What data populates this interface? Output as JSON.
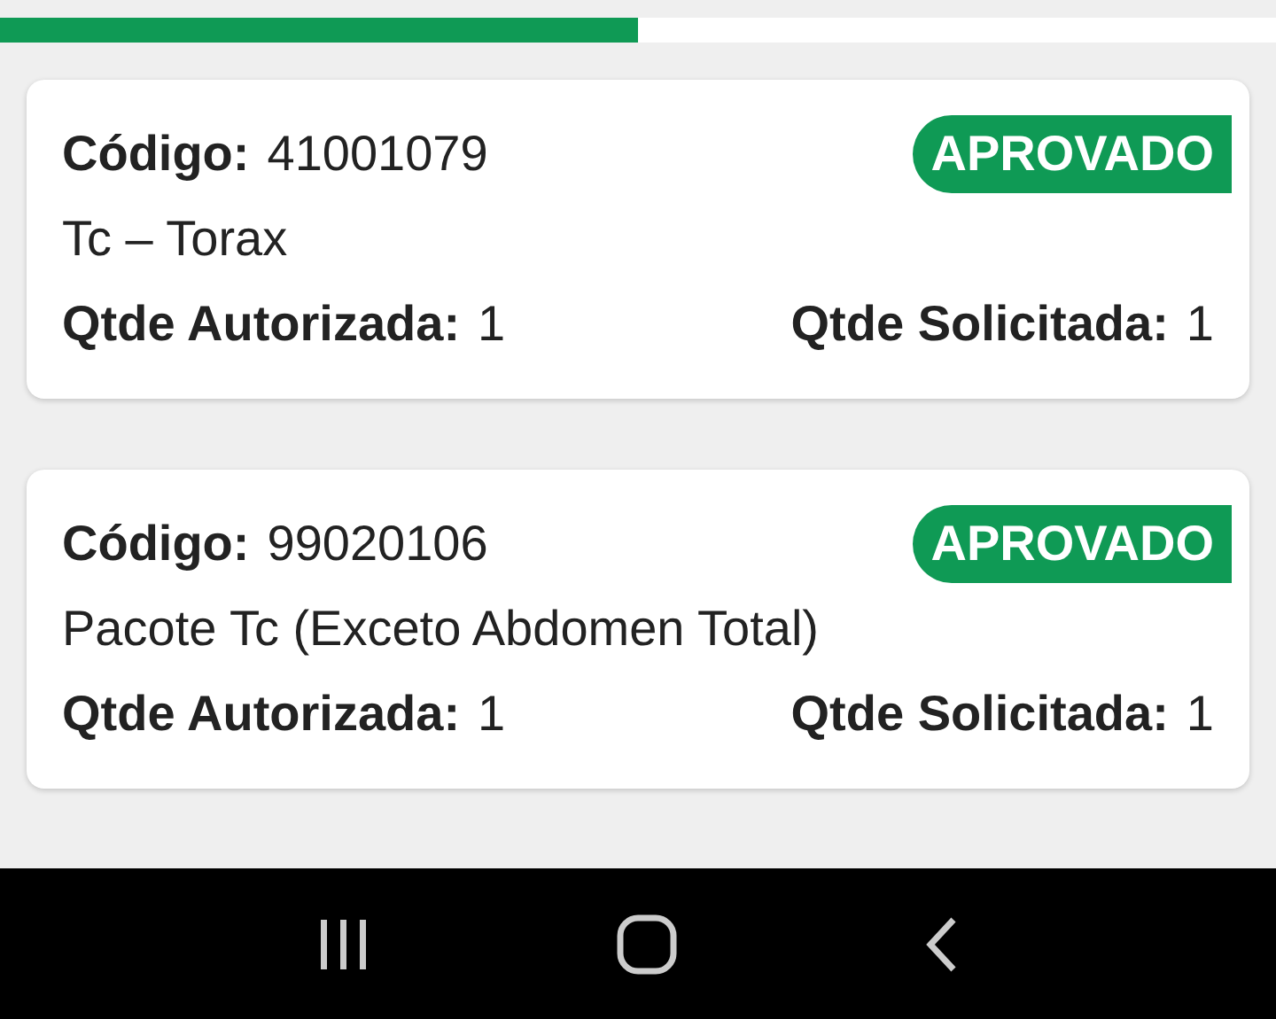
{
  "progress": {
    "level": 0.5
  },
  "items": [
    {
      "code_label": "Código:",
      "code": "41001079",
      "status": "APROVADO",
      "description": "Tc – Torax",
      "authorized_label": "Qtde Autorizada:",
      "authorized": "1",
      "requested_label": "Qtde Solicitada:",
      "requested": "1"
    },
    {
      "code_label": "Código:",
      "code": "99020106",
      "status": "APROVADO",
      "description": "Pacote Tc (Exceto Abdomen Total)",
      "authorized_label": "Qtde Autorizada:",
      "authorized": "1",
      "requested_label": "Qtde Solicitada:",
      "requested": "1"
    }
  ]
}
